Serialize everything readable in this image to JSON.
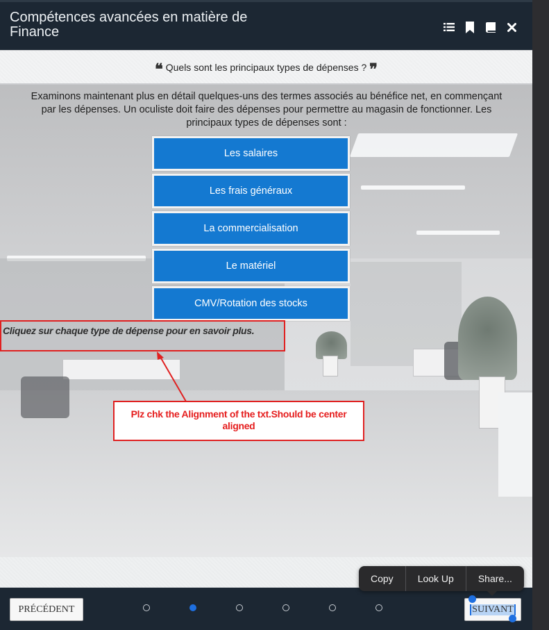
{
  "header": {
    "title": "Compétences avancées en matière de Finance",
    "icons": [
      "list-icon",
      "bookmark-icon",
      "book-icon",
      "close-icon"
    ]
  },
  "question": {
    "text": "Quels sont les principaux types de dépenses ?",
    "open_quote": "❝",
    "close_quote": "❞"
  },
  "intro": "Examinons maintenant plus en détail quelques-uns des termes associés au bénéfice net, en commençant par les dépenses. Un oculiste doit faire des dépenses pour permettre au magasin de fonctionner. Les principaux types de dépenses sont :",
  "expense_buttons": [
    {
      "label": "Les salaires"
    },
    {
      "label": "Les frais généraux"
    },
    {
      "label": "La commercialisation"
    },
    {
      "label": "Le matériel"
    },
    {
      "label": "CMV/Rotation des stocks"
    }
  ],
  "instruction": "Cliquez sur chaque type de dépense pour en savoir plus.",
  "review_comment": "Plz chk the Alignment of the txt.Should be center aligned",
  "navigation": {
    "prev_label": "PRÉCÉDENT",
    "next_label": "SUIVANT",
    "page_count": 6,
    "active_page": 2
  },
  "context_menu": {
    "items": [
      {
        "label": "Copy"
      },
      {
        "label": "Look Up"
      },
      {
        "label": "Share..."
      }
    ]
  },
  "colors": {
    "header_bg": "#1c2733",
    "button_blue": "#1479d1",
    "annotation_red": "#e02020",
    "selection_blue": "#1e6fe0"
  }
}
